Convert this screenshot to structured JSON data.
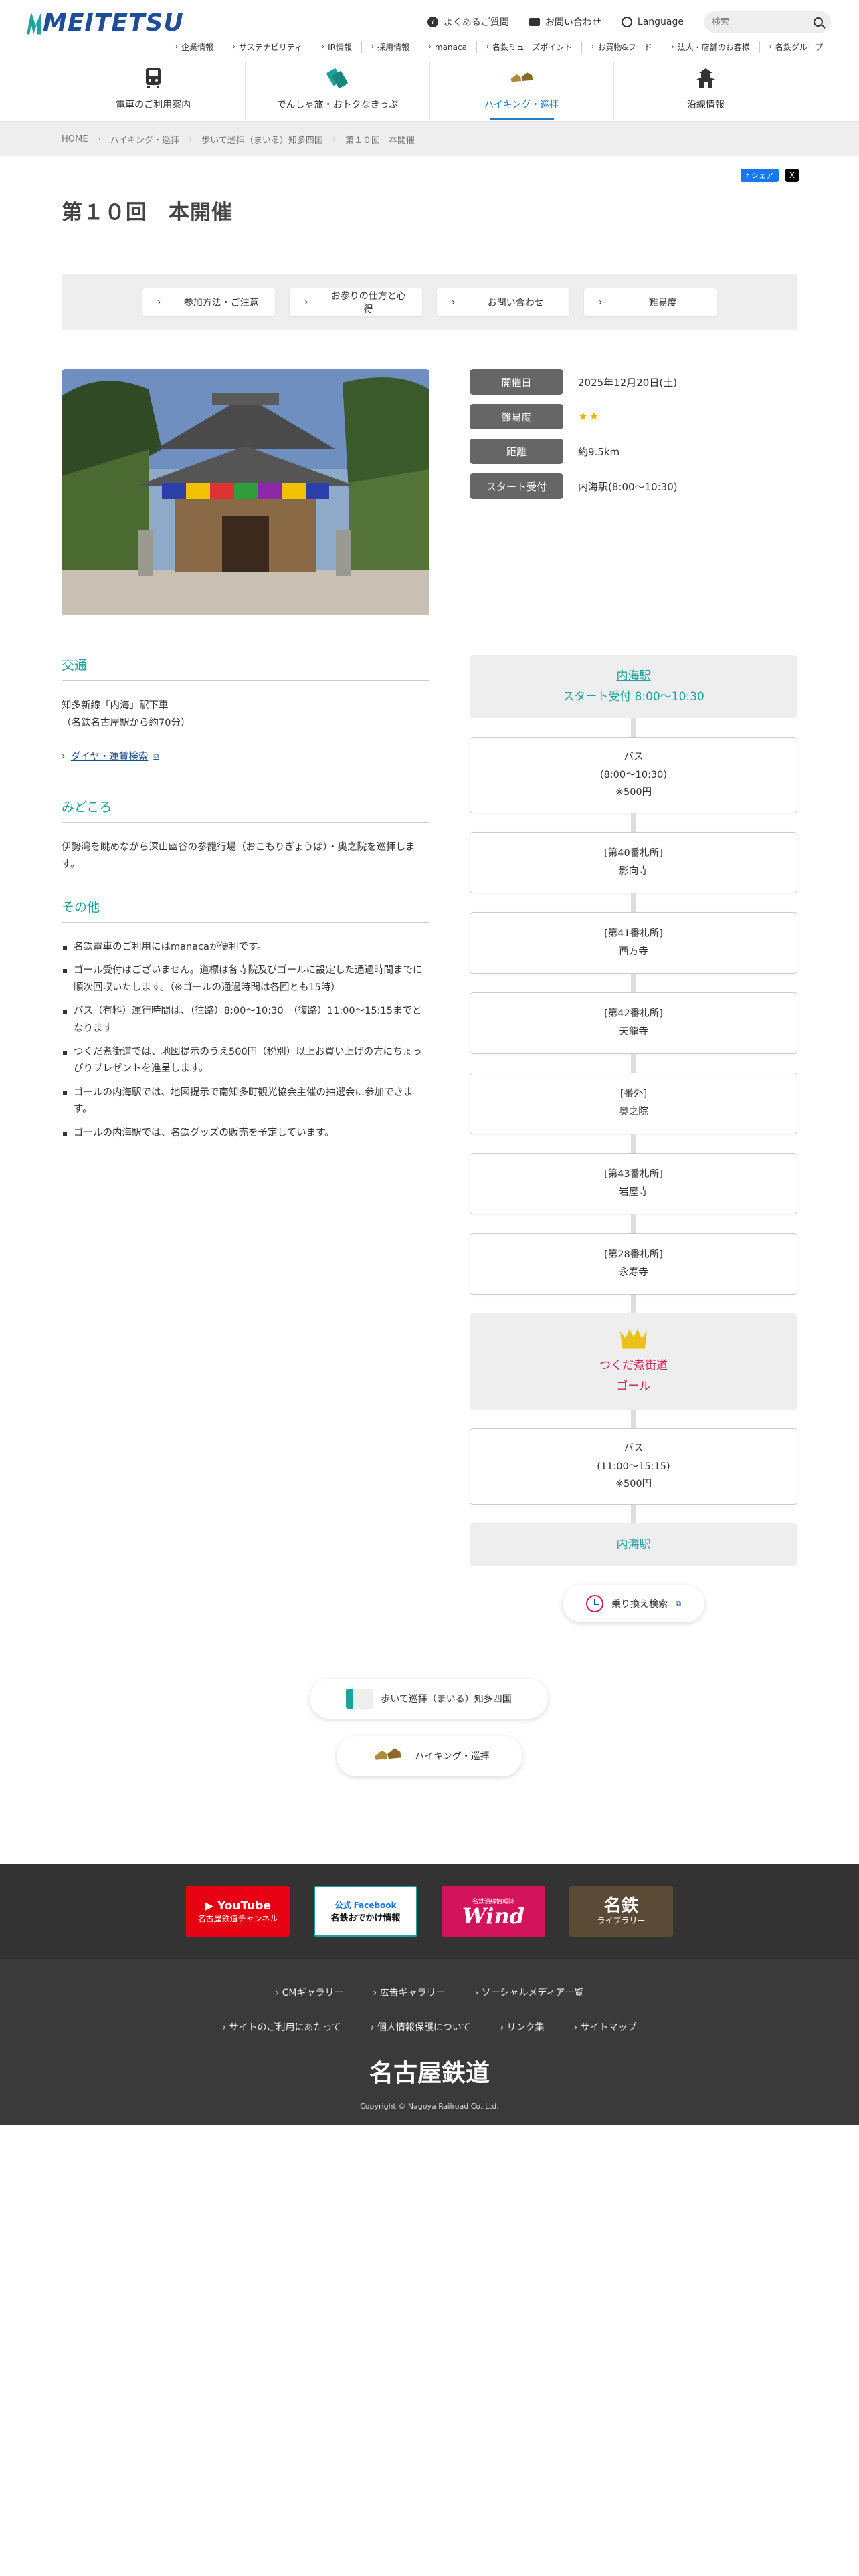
{
  "header": {
    "logo": "MEITETSU",
    "top_links": [
      {
        "label": "よくあるご質問",
        "icon": "question-icon"
      },
      {
        "label": "お問い合わせ",
        "icon": "mail-icon"
      },
      {
        "label": "Language",
        "icon": "globe-icon"
      }
    ],
    "search_placeholder": "検索",
    "subnav": [
      "企業情報",
      "サステナビリティ",
      "IR情報",
      "採用情報",
      "manaca",
      "名鉄ミューズポイント",
      "お買物&フード",
      "法人・店舗のお客様",
      "名鉄グループ"
    ],
    "mainnav": [
      {
        "label": "電車のご利用案内",
        "icon": "train-icon",
        "active": false
      },
      {
        "label": "でんしゃ旅・おトクなきっぷ",
        "icon": "ticket-icon",
        "active": false
      },
      {
        "label": "ハイキング・巡拝",
        "icon": "hiking-shoes-icon",
        "active": true
      },
      {
        "label": "沿線情報",
        "icon": "castle-icon",
        "active": false
      }
    ]
  },
  "breadcrumb": [
    "HOME",
    "ハイキング・巡拝",
    "歩いて巡拝（まいる）知多四国",
    "第１０回　本開催"
  ],
  "share": {
    "facebook": "シェア",
    "x": "X"
  },
  "page_title": "第１０回　本開催",
  "tabs": [
    "参加方法・ご注意",
    "お参りの仕方と心得",
    "お問い合わせ",
    "難易度"
  ],
  "info": [
    {
      "label": "開催日",
      "value": "2025年12月20日(土)"
    },
    {
      "label": "難易度",
      "value": "★★"
    },
    {
      "label": "距離",
      "value": "約9.5km"
    },
    {
      "label": "スタート受付",
      "value": "内海駅(8:00〜10:30)"
    }
  ],
  "sections": {
    "transport": {
      "title": "交通",
      "lines": [
        "知多新線「内海」駅下車",
        "（名鉄名古屋駅から約70分）"
      ],
      "link": "ダイヤ・運賃検索"
    },
    "highlight": {
      "title": "みどころ",
      "text": "伊勢湾を眺めながら深山幽谷の参籠行場（おこもりぎょうば）・奥之院を巡拝します。"
    },
    "other": {
      "title": "その他",
      "items": [
        "名鉄電車のご利用にはmanacaが便利です。",
        "ゴール受付はございません。道標は各寺院及びゴールに設定した通過時間までに順次回収いたします。（※ゴールの通過時間は各回とも15時）",
        "バス（有料）運行時間は、（往路）8:00〜10:30　（復路）11:00〜15:15までとなります",
        "つくだ煮街道では、地図提示のうえ500円（税別）以上お買い上げの方にちょっぴりプレゼントを進呈します。",
        "ゴールの内海駅では、地図提示で南知多町観光協会主催の抽選会に参加できます。",
        "ゴールの内海駅では、名鉄グッズの販売を予定しています。"
      ]
    }
  },
  "route": {
    "start": {
      "station": "内海駅",
      "note": "スタート受付 8:00〜10:30"
    },
    "bus1": [
      "バス",
      "(8:00〜10:30)",
      "※500円"
    ],
    "stops": [
      [
        "[第40番札所]",
        "影向寺"
      ],
      [
        "[第41番札所]",
        "西方寺"
      ],
      [
        "[第42番札所]",
        "天龍寺"
      ],
      [
        "[番外]",
        "奥之院"
      ],
      [
        "[第43番札所]",
        "岩屋寺"
      ],
      [
        "[第28番札所]",
        "永寿寺"
      ]
    ],
    "goal": [
      "つくだ煮街道",
      "ゴール"
    ],
    "bus2": [
      "バス",
      "(11:00〜15:15)",
      "※500円"
    ],
    "end": "内海駅",
    "transfer": "乗り換え検索"
  },
  "bottom_links": [
    "歩いて巡拝（まいる）知多四国",
    "ハイキング・巡拝"
  ],
  "banners": [
    {
      "title": "YouTube",
      "sub": "名古屋鉄道チャンネル",
      "color": "#e60012"
    },
    {
      "title": "公式 Facebook",
      "sub": "名鉄おでかけ情報",
      "color": "#ffffff"
    },
    {
      "title": "Wind",
      "sub": "名鉄沿線情報誌",
      "color": "#d3145a"
    },
    {
      "title": "名鉄",
      "sub": "ライブラリー",
      "color": "#5a4a36"
    }
  ],
  "footer": {
    "row1": [
      "CMギャラリー",
      "広告ギャラリー",
      "ソーシャルメディア一覧"
    ],
    "row2": [
      "サイトのご利用にあたって",
      "個人情報保護について",
      "リンク集",
      "サイトマップ"
    ],
    "brand": "名古屋鉄道",
    "copyright": "Copyright © Nagoya Railroad Co.,Ltd."
  }
}
